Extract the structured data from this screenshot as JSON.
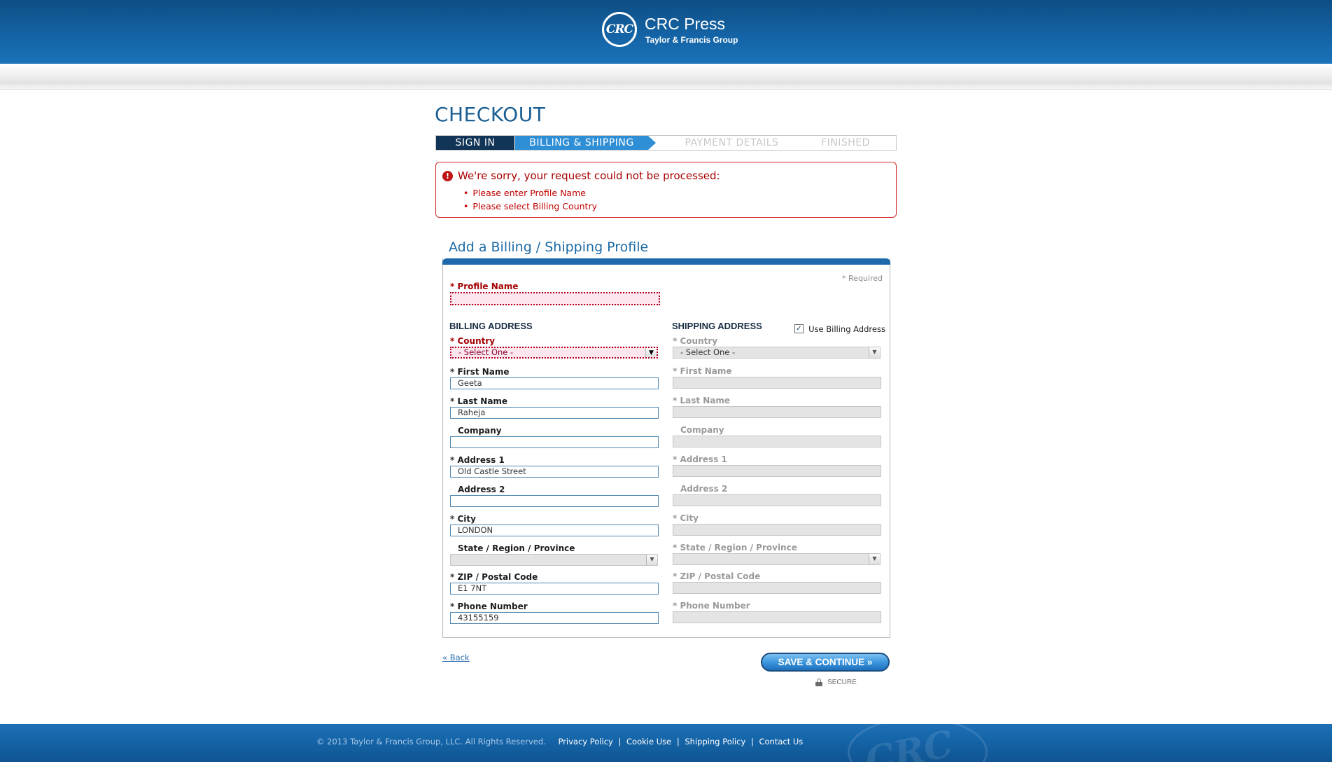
{
  "header": {
    "logo_mark": "CRC",
    "logo_name": "CRC Press",
    "logo_subtitle": "Taylor & Francis Group"
  },
  "checkout": {
    "title": "CHECKOUT",
    "steps": [
      "SIGN IN",
      "BILLING & SHIPPING",
      "PAYMENT DETAILS",
      "FINISHED"
    ],
    "active_step": "BILLING & SHIPPING"
  },
  "error": {
    "icon": "!",
    "title": "We're sorry, your request could not be processed:",
    "items": [
      "Please enter Profile Name",
      "Please select Billing Country"
    ]
  },
  "form": {
    "section_title": "Add a Billing / Shipping Profile",
    "required_note": "* Required",
    "profile_name": {
      "label": "Profile Name",
      "value": ""
    },
    "billing": {
      "heading": "BILLING ADDRESS",
      "country": {
        "label": "Country",
        "value": "- Select One -"
      },
      "first_name": {
        "label": "First Name",
        "value": "Geeta"
      },
      "last_name": {
        "label": "Last Name",
        "value": "Raheja"
      },
      "company": {
        "label": "Company",
        "value": ""
      },
      "address1": {
        "label": "Address 1",
        "value": "Old Castle Street"
      },
      "address2": {
        "label": "Address 2",
        "value": ""
      },
      "city": {
        "label": "City",
        "value": "LONDON"
      },
      "state": {
        "label": "State / Region / Province",
        "value": ""
      },
      "zip": {
        "label": "ZIP / Postal Code",
        "value": "E1 7NT"
      },
      "phone": {
        "label": "Phone Number",
        "value": "43155159"
      }
    },
    "shipping": {
      "heading": "SHIPPING ADDRESS",
      "use_billing_label": "Use Billing Address",
      "use_billing_checked": true,
      "country": {
        "label": "Country",
        "value": "- Select One -"
      },
      "first_name": {
        "label": "First Name"
      },
      "last_name": {
        "label": "Last Name"
      },
      "company": {
        "label": "Company"
      },
      "address1": {
        "label": "Address 1"
      },
      "address2": {
        "label": "Address 2"
      },
      "city": {
        "label": "City"
      },
      "state": {
        "label": "State / Region / Province"
      },
      "zip": {
        "label": "ZIP / Postal Code"
      },
      "phone": {
        "label": "Phone Number"
      }
    }
  },
  "actions": {
    "back_label": "« Back",
    "save_label": "SAVE & CONTINUE »",
    "secure_label": "SECURE"
  },
  "footer": {
    "copyright": "© 2013 Taylor & Francis Group, LLC. All Rights Reserved.",
    "links": [
      "Privacy Policy",
      "Cookie Use",
      "Shipping Policy",
      "Contact Us"
    ],
    "separator": "|",
    "watermark": "CRC"
  },
  "colors": {
    "header_blue": "#1463a5",
    "step_active": "#2f8fd6",
    "step_done": "#123557",
    "error_red": "#c00000",
    "title_blue": "#1a5f94"
  },
  "icons": {
    "required_marker": "*",
    "select_arrow": "▼",
    "checkbox_check": "✓"
  }
}
